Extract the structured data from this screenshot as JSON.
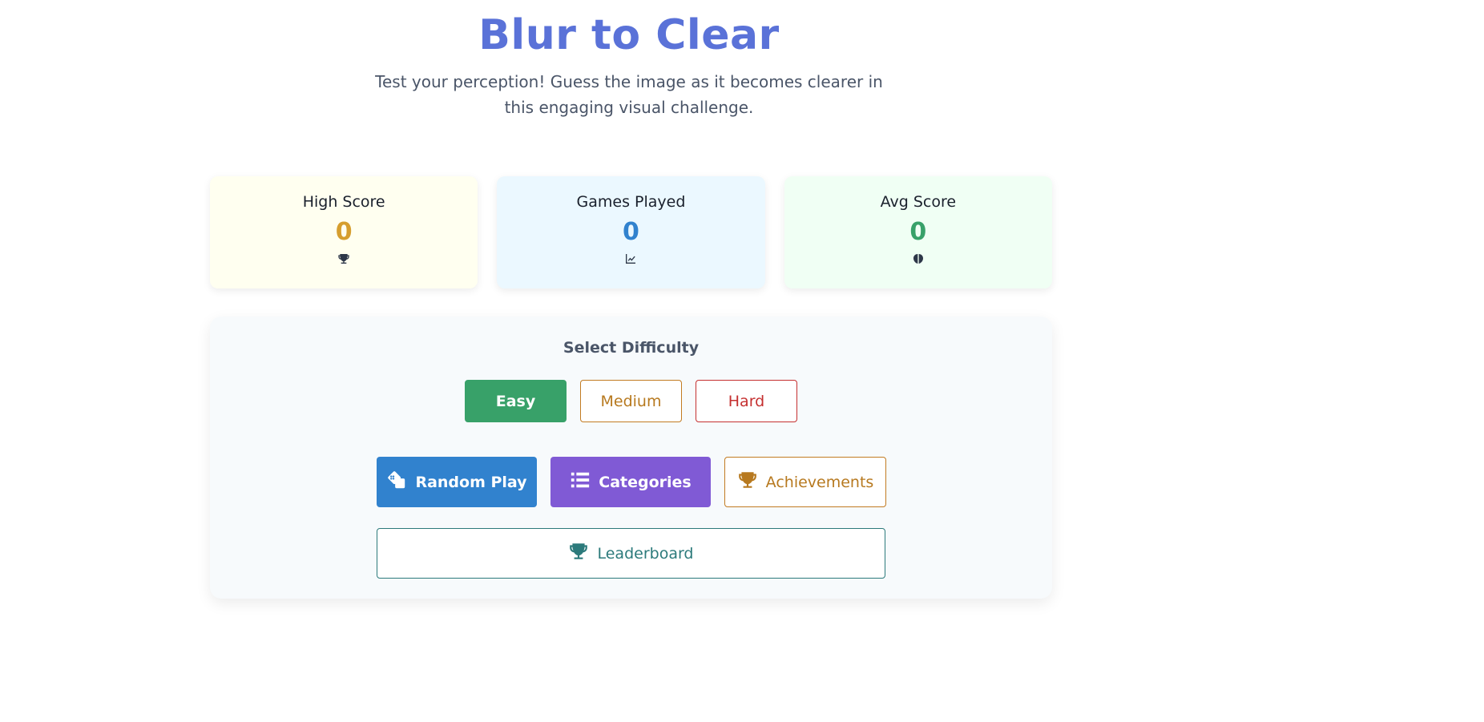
{
  "header": {
    "title": "Blur to Clear",
    "subtitle": "Test your perception! Guess the image as it becomes clearer in this engaging visual challenge."
  },
  "stats": [
    {
      "label": "High Score",
      "value": "0",
      "icon": "trophy-icon",
      "color": "#d69e2e"
    },
    {
      "label": "Games Played",
      "value": "0",
      "icon": "chart-line-icon",
      "color": "#3182ce"
    },
    {
      "label": "Avg Score",
      "value": "0",
      "icon": "brain-icon",
      "color": "#38a169"
    }
  ],
  "difficulty": {
    "title": "Select Difficulty",
    "options": [
      {
        "label": "Easy",
        "selected": true,
        "color": "#38a169"
      },
      {
        "label": "Medium",
        "selected": false,
        "color": "#b7791f"
      },
      {
        "label": "Hard",
        "selected": false,
        "color": "#c53030"
      }
    ]
  },
  "actions": {
    "random_play": {
      "label": "Random Play",
      "icon": "dice-icon",
      "color": "#3182ce"
    },
    "categories": {
      "label": "Categories",
      "icon": "list-icon",
      "color": "#805ad5"
    },
    "achievements": {
      "label": "Achievements",
      "icon": "trophy-icon",
      "color": "#b7791f"
    },
    "leaderboard": {
      "label": "Leaderboard",
      "icon": "trophy-icon",
      "color": "#2c7a7b"
    }
  }
}
